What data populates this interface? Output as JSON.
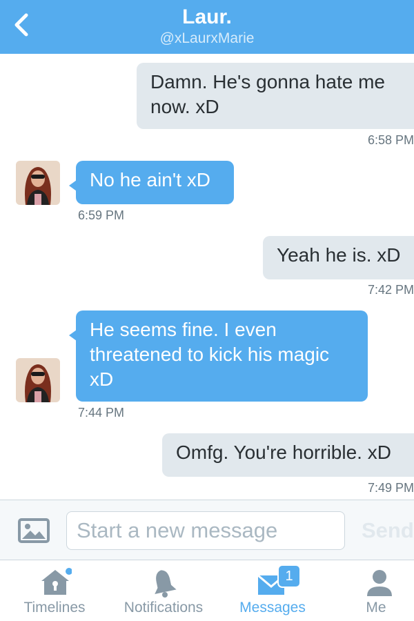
{
  "header": {
    "title": "Laur.",
    "handle": "@xLaurxMarie"
  },
  "messages": [
    {
      "direction": "outgoing",
      "lines": [
        "Damn. He's gonna hate me",
        "now. xD"
      ],
      "time": "6:58 PM"
    },
    {
      "direction": "incoming",
      "lines": [
        "No he ain't xD"
      ],
      "time": "6:59 PM"
    },
    {
      "direction": "outgoing",
      "lines": [
        "Yeah he is. xD"
      ],
      "time": "7:42 PM"
    },
    {
      "direction": "incoming",
      "lines": [
        "He seems fine. I even",
        "threatened to kick his magic",
        "xD"
      ],
      "time": "7:44 PM"
    },
    {
      "direction": "outgoing",
      "lines": [
        "Omfg. You're horrible. xD"
      ],
      "time": "7:49 PM"
    }
  ],
  "composer": {
    "placeholder": "Start a new message",
    "send_label": "Send"
  },
  "tabs": [
    {
      "label": "Timelines",
      "icon": "home-icon",
      "active": false,
      "dot": true
    },
    {
      "label": "Notifications",
      "icon": "bell-icon",
      "active": false
    },
    {
      "label": "Messages",
      "icon": "envelope-icon",
      "active": true,
      "badge": "1"
    },
    {
      "label": "Me",
      "icon": "person-icon",
      "active": false
    }
  ],
  "colors": {
    "brand": "#55acee",
    "outgoing_bubble": "#e1e8ed",
    "incoming_bubble": "#55acee",
    "muted_text": "#66757f"
  }
}
